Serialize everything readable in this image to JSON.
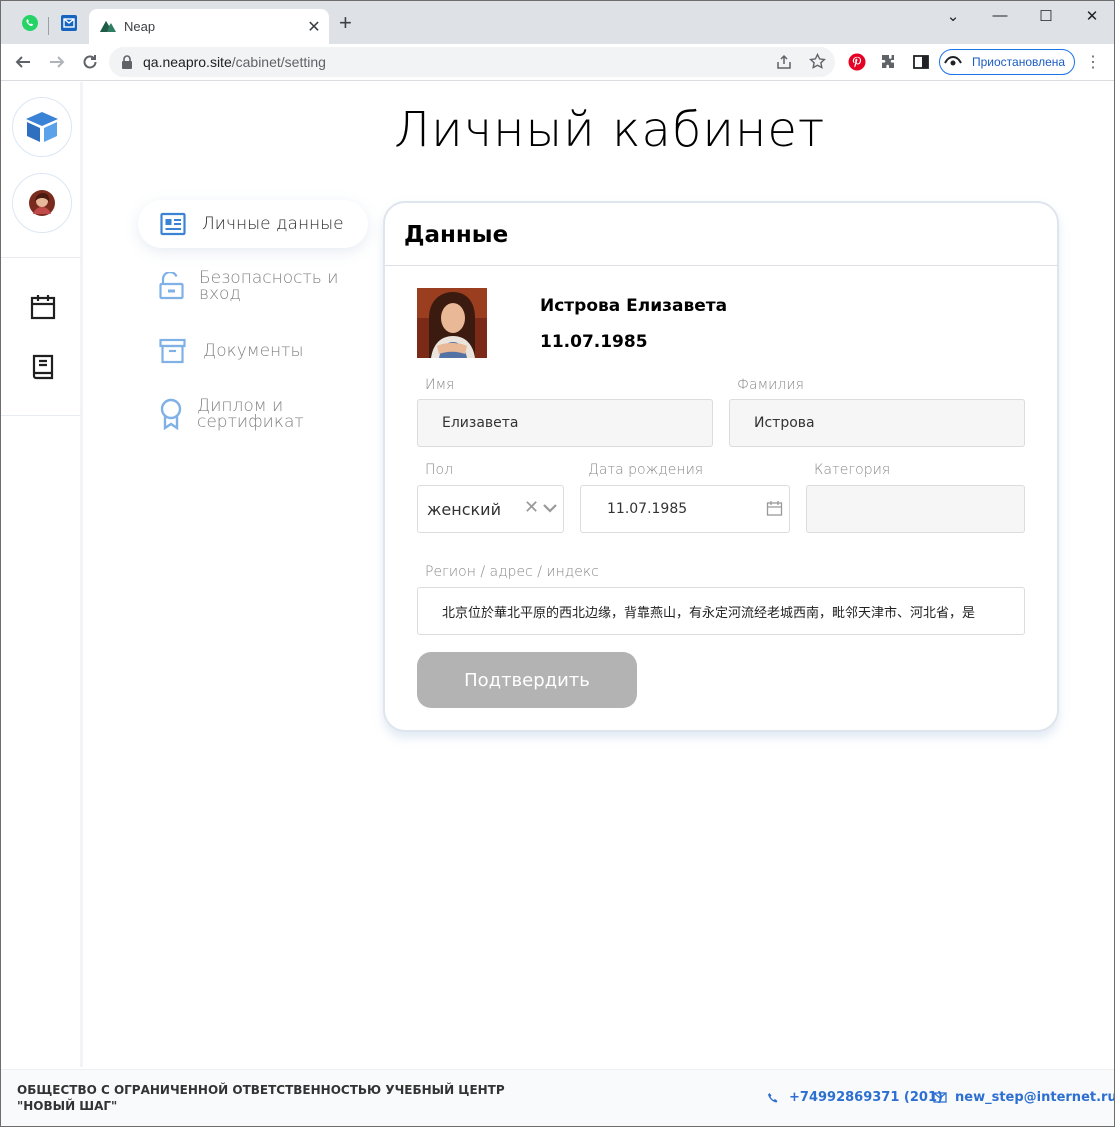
{
  "browser": {
    "tab_title": "Neap",
    "tab_close": "✕",
    "new_tab": "+",
    "url_host": "qa.neapro.site",
    "url_path": "/cabinet/setting",
    "profile_label": "Приостановлена",
    "window_controls": {
      "dropdown": "⌄",
      "minimize": "—",
      "maximize": "☐",
      "close": "✕"
    }
  },
  "sidebar": {
    "icons": [
      "logo-cube-icon",
      "user-avatar",
      "calendar-icon",
      "book-icon"
    ]
  },
  "page": {
    "title": "Личный кабинет"
  },
  "menu": {
    "items": [
      {
        "label": "Личные данные",
        "icon": "id-card-icon",
        "active": true
      },
      {
        "label": "Безопасность и вход",
        "icon": "unlock-icon",
        "active": false
      },
      {
        "label": "Документы",
        "icon": "archive-box-icon",
        "active": false
      },
      {
        "label": "Диплом и сертификат",
        "icon": "award-icon",
        "active": false
      }
    ]
  },
  "card": {
    "title": "Данные",
    "name": "Истрова Елизавета",
    "dob": "11.07.1985",
    "fields": {
      "first_name_label": "Имя",
      "first_name": "Елизавета",
      "last_name_label": "Фамилия",
      "last_name": "Истрова",
      "gender_label": "Пол",
      "gender": "женский",
      "birthdate_label": "Дата рождения",
      "birthdate": "11.07.1985",
      "category_label": "Категория",
      "category": "",
      "address_label": "Регион / адрес / индекс",
      "address": "北京位於華北平原的西北边缘，背靠燕山，有永定河流经老城西南，毗邻天津市、河北省，是"
    },
    "confirm_label": "Подтвердить"
  },
  "footer": {
    "company": "ОБЩЕСТВО С ОГРАНИЧЕННОЙ ОТВЕТСТВЕННОСТЬЮ УЧЕБНЫЙ ЦЕНТР \"НОВЫЙ ШАГ\"",
    "phone": "+74992869371 (201)",
    "email": "new_step@internet.ru"
  },
  "colors": {
    "accent": "#3a82d6",
    "link": "#2d6fd1",
    "button_disabled": "#b3b3b3"
  }
}
